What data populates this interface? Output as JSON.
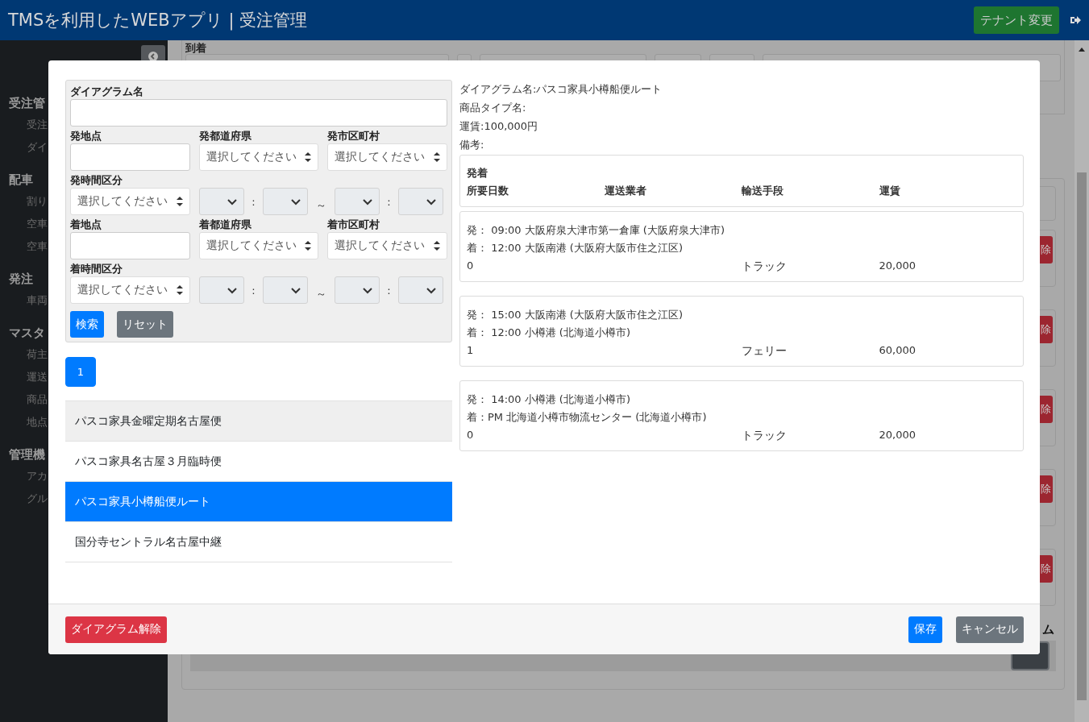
{
  "header": {
    "title": "TMSを利用したWEBアプリ | 受注管理",
    "tenant_button": "テナント変更"
  },
  "sidebar": {
    "sections": [
      {
        "title": "受注管",
        "items": [
          "受注",
          "ダイ"
        ]
      },
      {
        "title": "配車",
        "items": [
          "割り",
          "空車",
          "空車"
        ]
      },
      {
        "title": "発注",
        "items": [
          "車両"
        ]
      },
      {
        "title": "マスタ",
        "items": [
          "荷主",
          "運送",
          "商品",
          "地点"
        ]
      },
      {
        "title": "管理機",
        "items": [
          "アカ",
          "グル"
        ]
      }
    ]
  },
  "background": {
    "field_label": "到着",
    "delete_buttons": [
      "除",
      "除",
      "除",
      "除",
      "除"
    ],
    "column_heading": "ム"
  },
  "modal": {
    "search": {
      "rows": [
        {
          "cells": [
            {
              "kind": "text",
              "label": "ダイアグラム名"
            }
          ]
        },
        {
          "cells": [
            {
              "kind": "text",
              "label": "発地点"
            },
            {
              "kind": "select",
              "label": "発都道府県",
              "value": "選択してください"
            },
            {
              "kind": "select",
              "label": "発市区町村",
              "value": "選択してください"
            }
          ]
        },
        {
          "cells": [
            {
              "kind": "select",
              "label": "発時間区分",
              "value": "選択してください"
            },
            {
              "kind": "time_range",
              "disabled": true,
              "separators": [
                ":",
                "～",
                ":"
              ]
            }
          ]
        },
        {
          "cells": [
            {
              "kind": "text",
              "label": "着地点"
            },
            {
              "kind": "select",
              "label": "着都道府県",
              "value": "選択してください"
            },
            {
              "kind": "select",
              "label": "着市区町村",
              "value": "選択してください"
            }
          ]
        },
        {
          "cells": [
            {
              "kind": "select",
              "label": "着時間区分",
              "value": "選択してください"
            },
            {
              "kind": "time_range",
              "disabled": true,
              "separators": [
                ":",
                "～",
                ":"
              ]
            }
          ]
        }
      ],
      "buttons": [
        {
          "label": "検索",
          "kind": "primary"
        },
        {
          "label": "リセット",
          "kind": "secondary"
        }
      ]
    },
    "pagination": [
      {
        "label": "1",
        "selected": true
      }
    ],
    "diagrams": [
      {
        "name": "パスコ家具金曜定期名古屋便",
        "selected": false,
        "hover": true
      },
      {
        "name": "パスコ家具名古屋３月臨時便",
        "selected": false,
        "hover": false
      },
      {
        "name": "パスコ家具小樽船便ルート",
        "selected": true,
        "hover": false
      },
      {
        "name": "国分寺セントラル名古屋中継",
        "selected": false,
        "hover": false
      }
    ],
    "detail": {
      "lines": [
        "ダイアグラム名:パスコ家具小樽船便ルート",
        "商品タイプ名:",
        "運賃:100,000円",
        "備考:"
      ],
      "heading": "発着",
      "columns": [
        "所要日数",
        "運送業者",
        "輸送手段",
        "運賃"
      ],
      "legs": [
        {
          "depart": "発： 09:00 大阪府泉大津市第一倉庫 (大阪府泉大津市)",
          "arrive": "着： 12:00 大阪南港 (大阪府大阪市住之江区)",
          "days": "0",
          "mode": "トラック",
          "fare": "20,000"
        },
        {
          "depart": "発： 15:00 大阪南港 (大阪府大阪市住之江区)",
          "arrive": "着： 12:00 小樽港 (北海道小樽市)",
          "days": "1",
          "mode": "フェリー",
          "fare": "60,000"
        },
        {
          "depart": "発： 14:00 小樽港 (北海道小樽市)",
          "arrive": "着：PM 北海道小樽市物流センター (北海道小樽市)",
          "days": "0",
          "mode": "トラック",
          "fare": "20,000"
        }
      ]
    },
    "footer": {
      "release_button": "ダイアグラム解除",
      "save_button": "保存",
      "cancel_button": "キャンセル"
    }
  }
}
